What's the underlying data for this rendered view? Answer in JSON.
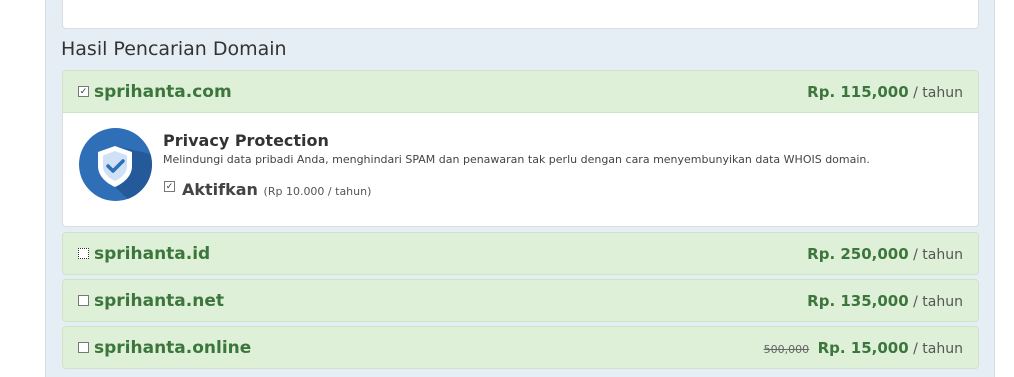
{
  "section_title": "Hasil Pencarian Domain",
  "per_year": "/ tahun",
  "domains": [
    {
      "name": "sprihanta.com",
      "price": "Rp. 115,000",
      "old_price": "",
      "checked": true
    },
    {
      "name": "sprihanta.id",
      "price": "Rp. 250,000",
      "old_price": "",
      "checked": false
    },
    {
      "name": "sprihanta.net",
      "price": "Rp. 135,000",
      "old_price": "",
      "checked": false
    },
    {
      "name": "sprihanta.online",
      "price": "Rp. 15,000",
      "old_price": "500,000",
      "checked": false
    }
  ],
  "privacy": {
    "title": "Privacy Protection",
    "description": "Melindungi data pribadi Anda, menghindari SPAM dan penawaran tak perlu dengan cara menyembunyikan data WHOIS domain.",
    "enable_label": "Aktifkan",
    "enable_note": "(Rp 10.000 / tahun)",
    "enabled": true,
    "icon": "shield-check-icon"
  },
  "colors": {
    "accent_green": "#3c763d",
    "row_bg": "#dff0d8",
    "panel_bg": "#e6eef5",
    "shield_blue": "#2f6fb8"
  }
}
